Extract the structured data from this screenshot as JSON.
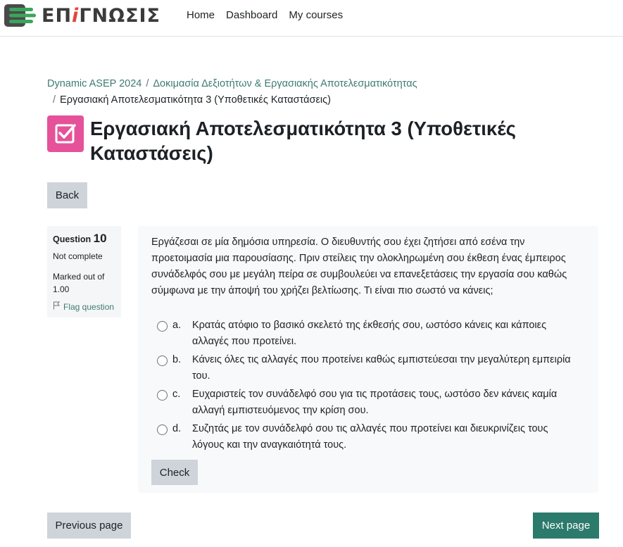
{
  "brand": {
    "logo_text_prefix": "ΕΠ",
    "logo_text_accent": "i",
    "logo_text_suffix": "ΓΝΩΣΙΣ",
    "accent_color": "#e0473b",
    "mark_color": "#3aa55c"
  },
  "nav": {
    "items": [
      "Home",
      "Dashboard",
      "My courses"
    ]
  },
  "breadcrumb": {
    "items": [
      "Dynamic ASEP 2024",
      "Δοκιμασία Δεξιοτήτων & Εργασιακής Αποτελεσματικότητας",
      "Εργασιακή Αποτελεσματικότητα 3 (Υποθετικές Καταστάσεις)"
    ],
    "separator": "/"
  },
  "page": {
    "title": "Εργασιακή Αποτελεσματικότητα 3 (Υποθετικές Καταστάσεις)",
    "icon": "checkbox-icon",
    "icon_color": "#e5529a"
  },
  "buttons": {
    "back": "Back",
    "check": "Check",
    "previous": "Previous page",
    "next": "Next page",
    "next_color": "#2b7a6b"
  },
  "question": {
    "label": "Question",
    "number": "10",
    "state": "Not complete",
    "marked_out_of": "Marked out of 1.00",
    "flag": "Flag question",
    "text": "Εργάζεσαι σε μία δημόσια υπηρεσία. Ο διευθυντής σου έχει ζητήσει από εσένα την προετοιμασία μια παρουσίασης. Πριν στείλεις την ολοκληρωμένη σου έκθεση ένας έμπειρος συνάδελφός σου με μεγάλη πείρα σε συμβουλεύει να επανεξετάσεις την εργασία σου καθώς σύμφωνα με την άποψή του χρήζει βελτίωσης. Τι είναι πιο σωστό να κάνεις;",
    "answers": [
      {
        "letter": "a.",
        "text": "Κρατάς ατόφιο το βασικό σκελετό της έκθεσής σου, ωστόσο κάνεις και κάποιες αλλαγές που προτείνει."
      },
      {
        "letter": "b.",
        "text": "Κάνεις όλες τις αλλαγές που προτείνει καθώς εμπιστεύεσαι την μεγαλύτερη εμπειρία του."
      },
      {
        "letter": "c.",
        "text": "Ευχαριστείς τον συνάδελφό σου για τις προτάσεις τους, ωστόσο δεν κάνεις καμία αλλαγή εμπιστευόμενος την κρίση σου."
      },
      {
        "letter": "d.",
        "text": "Συζητάς με τον συνάδελφό σου τις αλλαγές που προτείνει και διευκρινίζεις τους λόγους και την αναγκαιότητά τους."
      }
    ]
  }
}
